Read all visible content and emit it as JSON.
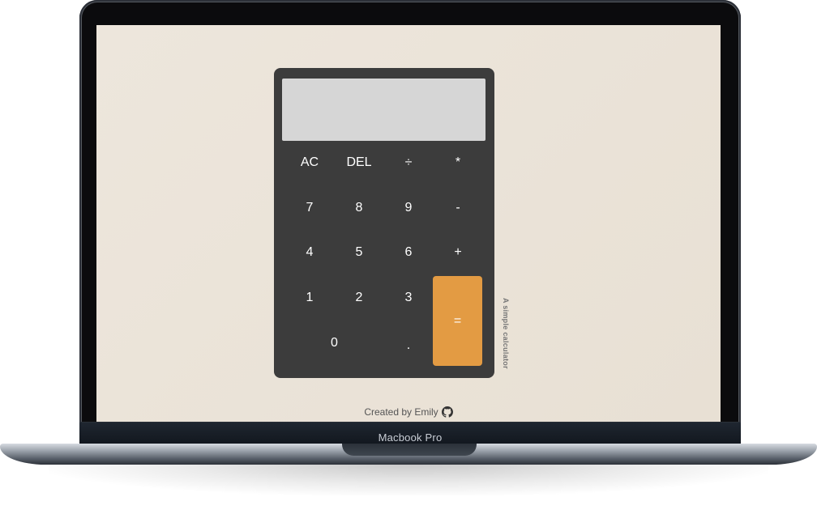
{
  "device": {
    "model_label": "Macbook Pro"
  },
  "calculator": {
    "display_value": "",
    "keys": [
      {
        "label": "AC",
        "name": "all-clear-button"
      },
      {
        "label": "DEL",
        "name": "delete-button"
      },
      {
        "label": "÷",
        "name": "divide-button"
      },
      {
        "label": "*",
        "name": "multiply-button"
      },
      {
        "label": "7",
        "name": "digit-7-button"
      },
      {
        "label": "8",
        "name": "digit-8-button"
      },
      {
        "label": "9",
        "name": "digit-9-button"
      },
      {
        "label": "-",
        "name": "subtract-button"
      },
      {
        "label": "4",
        "name": "digit-4-button"
      },
      {
        "label": "5",
        "name": "digit-5-button"
      },
      {
        "label": "6",
        "name": "digit-6-button"
      },
      {
        "label": "+",
        "name": "add-button"
      },
      {
        "label": "1",
        "name": "digit-1-button"
      },
      {
        "label": "2",
        "name": "digit-2-button"
      },
      {
        "label": "3",
        "name": "digit-3-button"
      },
      {
        "label": "=",
        "name": "equals-button"
      },
      {
        "label": "0",
        "name": "digit-0-button"
      },
      {
        "label": ".",
        "name": "decimal-button"
      }
    ],
    "accent_color": "#e39b43",
    "body_color": "#3c3c3c",
    "display_color": "#d6d6d6"
  },
  "side_caption": "A simple calculator",
  "footer": {
    "text": "Created by Emily",
    "icon": "github-icon"
  }
}
